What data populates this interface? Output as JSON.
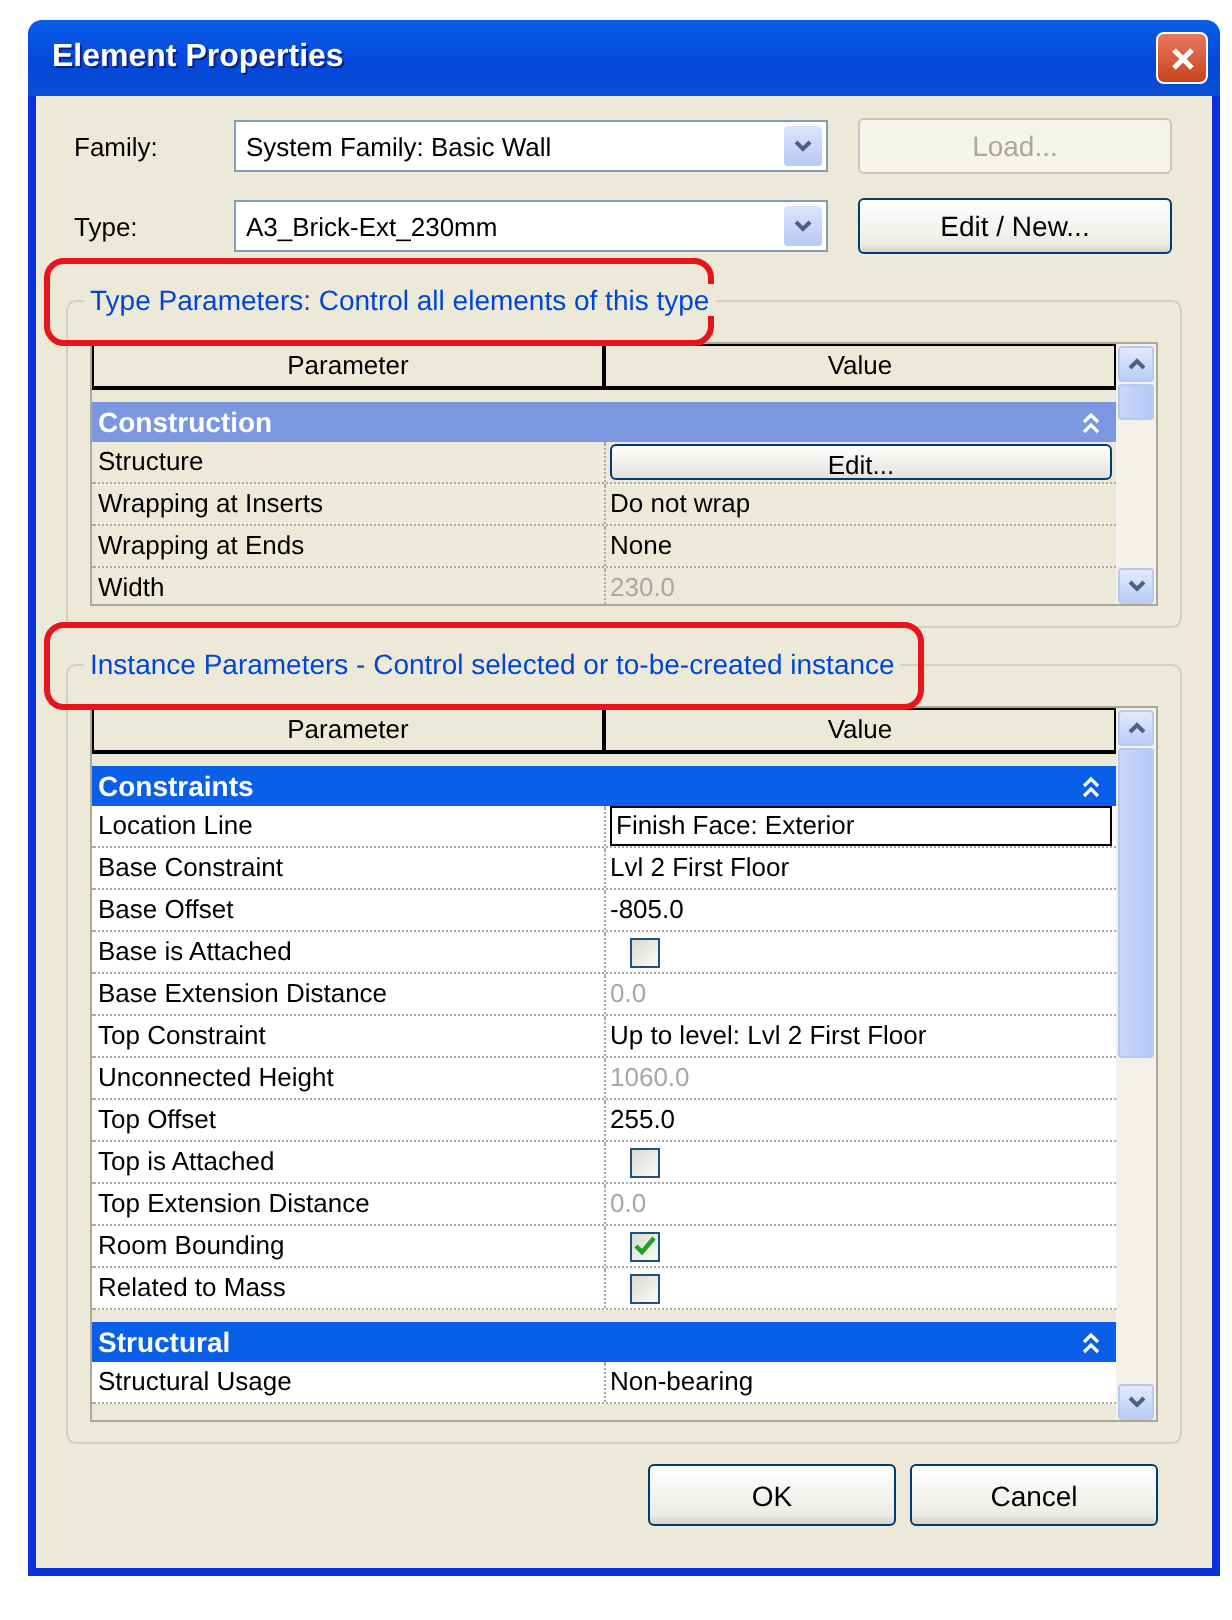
{
  "window": {
    "title": "Element Properties"
  },
  "family": {
    "label": "Family:",
    "value": "System Family: Basic Wall"
  },
  "type": {
    "label": "Type:",
    "value": "A3_Brick-Ext_230mm"
  },
  "side_buttons": [
    {
      "label": "Load...",
      "disabled": true
    },
    {
      "label": "Edit / New...",
      "disabled": false
    }
  ],
  "type_parameters": {
    "title": "Type Parameters: Control all elements of this type",
    "highlighted": true,
    "focused": false,
    "columns": [
      "Parameter",
      "Value"
    ],
    "sections": [
      {
        "title": "Construction",
        "rows": [
          {
            "label": "Structure",
            "kind": "button",
            "value": "Edit..."
          },
          {
            "label": "Wrapping at Inserts",
            "kind": "text",
            "value": "Do not wrap",
            "disabled": false
          },
          {
            "label": "Wrapping at Ends",
            "kind": "text",
            "value": "None",
            "disabled": false
          },
          {
            "label": "Width",
            "kind": "text",
            "value": "230.0",
            "disabled": true
          }
        ]
      }
    ]
  },
  "instance_parameters": {
    "title": "Instance Parameters - Control selected or to-be-created instance",
    "highlighted": true,
    "focused": true,
    "columns": [
      "Parameter",
      "Value"
    ],
    "sections": [
      {
        "title": "Constraints",
        "rows": [
          {
            "label": "Location Line",
            "kind": "field",
            "value": "Finish Face: Exterior"
          },
          {
            "label": "Base Constraint",
            "kind": "text",
            "value": "Lvl 2 First Floor",
            "disabled": false
          },
          {
            "label": "Base Offset",
            "kind": "text",
            "value": "-805.0",
            "disabled": false
          },
          {
            "label": "Base is Attached",
            "kind": "checkbox",
            "checked": false
          },
          {
            "label": "Base Extension Distance",
            "kind": "text",
            "value": "0.0",
            "disabled": true
          },
          {
            "label": "Top Constraint",
            "kind": "text",
            "value": "Up to level: Lvl 2 First Floor",
            "disabled": false
          },
          {
            "label": "Unconnected Height",
            "kind": "text",
            "value": "1060.0",
            "disabled": true
          },
          {
            "label": "Top Offset",
            "kind": "text",
            "value": "255.0",
            "disabled": false
          },
          {
            "label": "Top is Attached",
            "kind": "checkbox",
            "checked": false
          },
          {
            "label": "Top Extension Distance",
            "kind": "text",
            "value": "0.0",
            "disabled": true
          },
          {
            "label": "Room Bounding",
            "kind": "checkbox",
            "checked": true
          },
          {
            "label": "Related to Mass",
            "kind": "checkbox",
            "checked": false
          }
        ]
      },
      {
        "title": "Structural",
        "rows": [
          {
            "label": "Structural Usage",
            "kind": "text",
            "value": "Non-bearing",
            "disabled": false
          }
        ]
      }
    ]
  },
  "buttons": [
    "OK",
    "Cancel"
  ]
}
